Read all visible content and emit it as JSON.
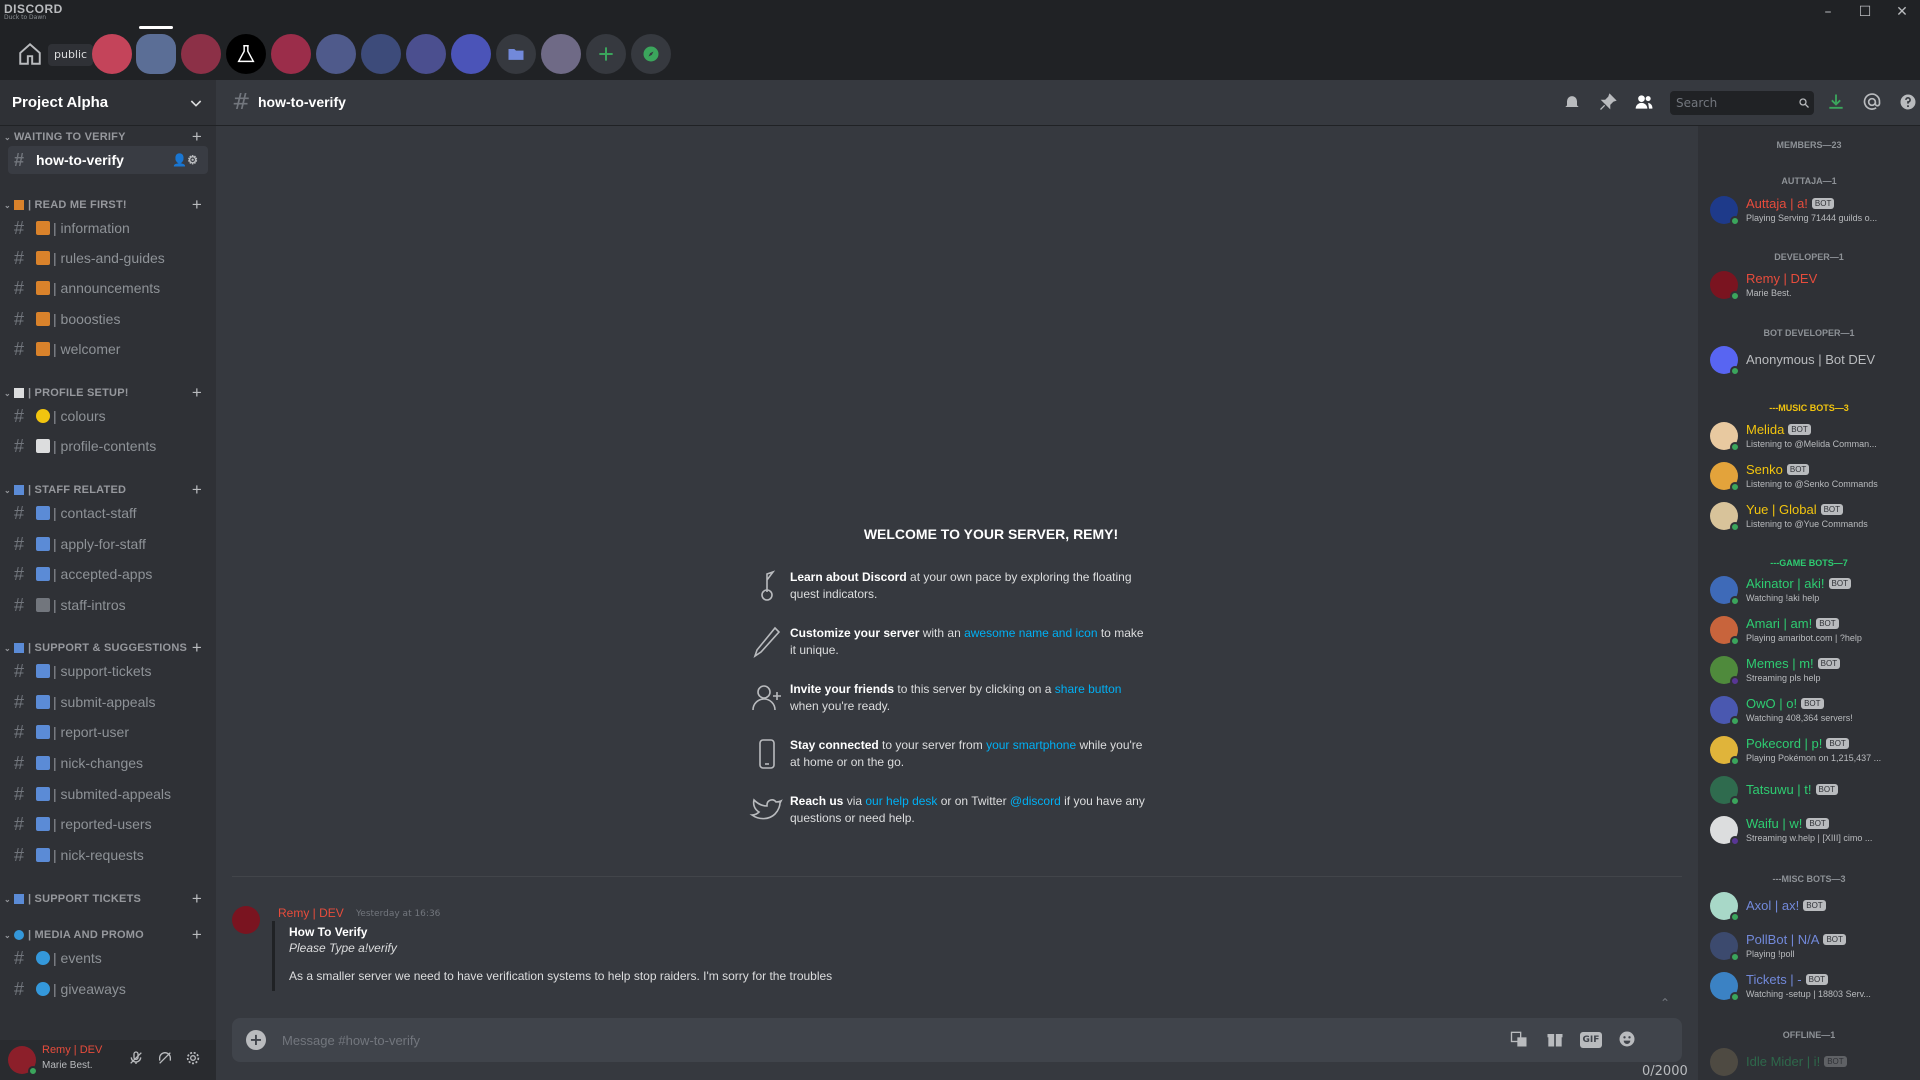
{
  "app": {
    "logo": "DISCORD",
    "logo_sub": "Duck to Dawn"
  },
  "guild_bar": {
    "public_label": "public"
  },
  "colors": {
    "accent": "#5865f2",
    "link": "#00b0f4",
    "dev_red": "#e74c3c",
    "music_yellow": "#f1c40f",
    "game_green": "#2ecc71",
    "misc_blue": "#7289da"
  },
  "server": {
    "name": "Project Alpha"
  },
  "categories": [
    {
      "label": "WAITING TO VERIFY",
      "channels": [
        {
          "name": "how-to-verify"
        }
      ]
    },
    {
      "label": "| READ ME FIRST!",
      "channels": [
        {
          "name": "| information"
        },
        {
          "name": "| rules-and-guides"
        },
        {
          "name": "| announcements"
        },
        {
          "name": "| booosties"
        },
        {
          "name": "| welcomer"
        }
      ]
    },
    {
      "label": "| PROFILE SETUP!",
      "channels": [
        {
          "name": "| colours"
        },
        {
          "name": "| profile-contents"
        }
      ]
    },
    {
      "label": "| STAFF RELATED",
      "channels": [
        {
          "name": "| contact-staff"
        },
        {
          "name": "| apply-for-staff"
        },
        {
          "name": "| accepted-apps"
        },
        {
          "name": "| staff-intros"
        }
      ]
    },
    {
      "label": "| SUPPORT & SUGGESTIONS",
      "channels": [
        {
          "name": "| support-tickets"
        },
        {
          "name": "| submit-appeals"
        },
        {
          "name": "| report-user"
        },
        {
          "name": "| nick-changes"
        },
        {
          "name": "| submited-appeals"
        },
        {
          "name": "| reported-users"
        },
        {
          "name": "| nick-requests"
        }
      ]
    },
    {
      "label": "| SUPPORT TICKETS",
      "channels": []
    },
    {
      "label": "| MEDIA AND PROMO",
      "channels": [
        {
          "name": "| events"
        },
        {
          "name": "| giveaways"
        }
      ]
    }
  ],
  "user_panel": {
    "name": "Remy | DEV",
    "status": "Marie Best."
  },
  "channel_header": {
    "title": "how-to-verify",
    "search_placeholder": "Search"
  },
  "welcome": {
    "title": "WELCOME TO YOUR SERVER, REMY!",
    "tips": [
      {
        "icon": "quest-icon",
        "bold": "Learn about Discord",
        "pre": "",
        "text": " at your own pace by exploring the floating quest indicators.",
        "link": "",
        "post": ""
      },
      {
        "icon": "brush-icon",
        "bold": "Customize your server",
        "text": " with an ",
        "link": "awesome name and icon",
        "post": " to make it unique."
      },
      {
        "icon": "invite-icon",
        "bold": "Invite your friends",
        "text": " to this server by clicking on a ",
        "link": "share button",
        "post": " when you're ready."
      },
      {
        "icon": "phone-icon",
        "bold": "Stay connected",
        "text": " to your server from ",
        "link": "your smartphone",
        "post": " while you're at home or on the go."
      },
      {
        "icon": "twitter-icon",
        "bold": "Reach us",
        "text": " via ",
        "link": "our help desk",
        "mid": " or on Twitter ",
        "link2": "@discord",
        "post": " if you have any questions or need help."
      }
    ]
  },
  "message": {
    "author": "Remy | DEV",
    "timestamp": "Yesterday at 16:36",
    "embed_title": "How To Verify",
    "embed_subtitle": "Please Type a!verify",
    "embed_body": "As a smaller server we need to have verification systems to help stop raiders. I'm sorry for the troubles"
  },
  "composer": {
    "placeholder": "Message #how-to-verify",
    "char_count": "0/2000",
    "gif_label": "GIF"
  },
  "members": {
    "header": "MEMBERS—23",
    "groups": [
      {
        "label": "AUTTAJA—1",
        "color": "#e74c3c",
        "members": [
          {
            "name": "Auttaja | a!",
            "bot": "BOT",
            "status": "Playing Serving 71444 guilds o..."
          }
        ]
      },
      {
        "label": "DEVELOPER—1",
        "color": "#e74c3c",
        "members": [
          {
            "name": "Remy | DEV",
            "bot": "",
            "status": "Marie Best."
          }
        ]
      },
      {
        "label": "BOT DEVELOPER—1",
        "color": "#b9bbbe",
        "members": [
          {
            "name": "Anonymous | Bot DEV",
            "bot": "",
            "status": ""
          }
        ]
      },
      {
        "label": "---MUSIC BOTS—3",
        "color": "#f1c40f",
        "members": [
          {
            "name": "Melida",
            "bot": "BOT",
            "status": "Listening to @Melida Comman..."
          },
          {
            "name": "Senko",
            "bot": "BOT",
            "status": "Listening to @Senko Commands"
          },
          {
            "name": "Yue | Global",
            "bot": "BOT",
            "status": "Listening to @Yue Commands"
          }
        ]
      },
      {
        "label": "---GAME BOTS—7",
        "color": "#2ecc71",
        "members": [
          {
            "name": "Akinator | aki!",
            "bot": "BOT",
            "status": "Watching !aki help"
          },
          {
            "name": "Amari | am!",
            "bot": "BOT",
            "status": "Playing amaribot.com | ?help"
          },
          {
            "name": "Memes | m!",
            "bot": "BOT",
            "status": "Streaming pls help"
          },
          {
            "name": "OwO | o!",
            "bot": "BOT",
            "status": "Watching 408,364 servers!"
          },
          {
            "name": "Pokecord | p!",
            "bot": "BOT",
            "status": "Playing Pokémon on 1,215,437 ..."
          },
          {
            "name": "Tatsuwu | t!",
            "bot": "BOT",
            "status": ""
          },
          {
            "name": "Waifu | w!",
            "bot": "BOT",
            "status": "Streaming w.help | [XIII] cimo ..."
          }
        ]
      },
      {
        "label": "---MISC BOTS—3",
        "color": "#7289da",
        "members": [
          {
            "name": "Axol | ax!",
            "bot": "BOT",
            "status": ""
          },
          {
            "name": "PollBot | N/A",
            "bot": "BOT",
            "status": "Playing !poll"
          },
          {
            "name": "Tickets | -",
            "bot": "BOT",
            "status": "Watching -setup | 18803 Serv..."
          }
        ]
      },
      {
        "label": "OFFLINE—1",
        "color": "#72767d",
        "members": [
          {
            "name": "Idle Mider | i!",
            "bot": "BOT",
            "status": ""
          }
        ]
      }
    ]
  }
}
